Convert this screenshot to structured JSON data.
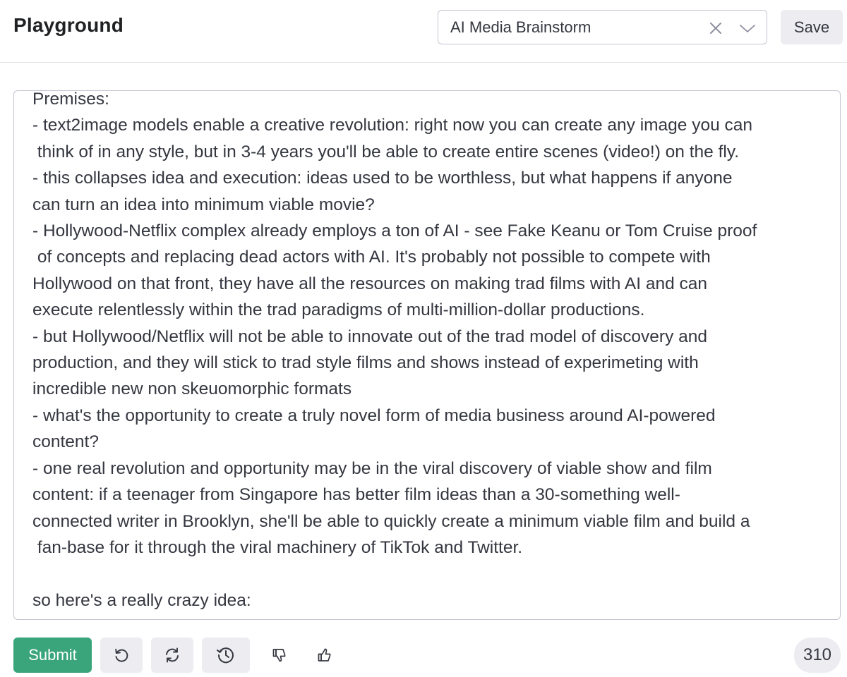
{
  "header": {
    "title": "Playground",
    "preset": {
      "value": "AI Media Brainstorm",
      "clear_icon": "x-icon",
      "dropdown_icon": "chevron-down-icon"
    },
    "save_label": "Save"
  },
  "editor": {
    "text": "Premises:\n- text2image models enable a creative revolution: right now you can create any image you can\n think of in any style, but in 3-4 years you'll be able to create entire scenes (video!) on the fly.\n- this collapses idea and execution: ideas used to be worthless, but what happens if anyone\ncan turn an idea into minimum viable movie?\n- Hollywood-Netflix complex already employs a ton of AI - see Fake Keanu or Tom Cruise proof\n of concepts and replacing dead actors with AI. It's probably not possible to compete with\nHollywood on that front, they have all the resources on making trad films with AI and can\nexecute relentlessly within the trad paradigms of multi-million-dollar productions.\n- but Hollywood/Netflix will not be able to innovate out of the trad model of discovery and\nproduction, and they will stick to trad style films and shows instead of experimeting with\nincredible new non skeuomorphic formats\n- what's the opportunity to create a truly novel form of media business around AI-powered\ncontent?\n- one real revolution and opportunity may be in the viral discovery of viable show and film\ncontent: if a teenager from Singapore has better film ideas than a 30-something well-\nconnected writer in Brooklyn, she'll be able to quickly create a minimum viable film and build a\n fan-base for it through the viral machinery of TikTok and Twitter.\n\nso here's a really crazy idea:"
  },
  "footer": {
    "submit_label": "Submit",
    "icons": [
      "undo-icon",
      "regenerate-icon",
      "history-icon",
      "thumbs-down-icon",
      "thumbs-up-icon"
    ],
    "token_count": "310"
  },
  "colors": {
    "submit_bg": "#3aa57b",
    "button_bg": "#ececf1",
    "border": "#c5c5d2",
    "text": "#353740"
  }
}
